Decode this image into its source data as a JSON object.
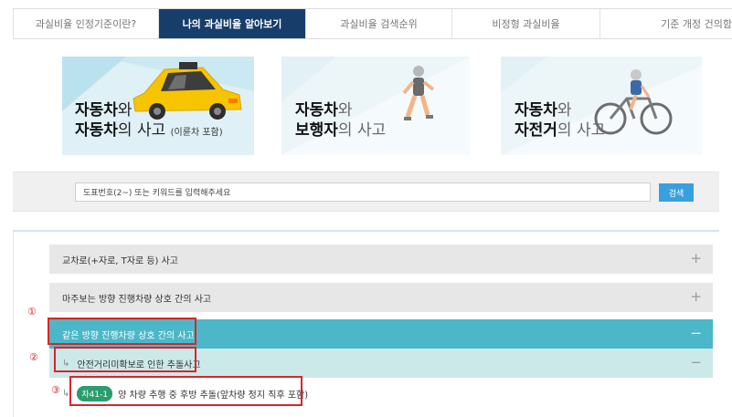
{
  "tabs": [
    {
      "label": "과실비율 인정기준이란?",
      "active": false
    },
    {
      "label": "나의 과실비율 알아보기",
      "active": true
    },
    {
      "label": "과실비율 검색순위",
      "active": false
    },
    {
      "label": "비정형 과실비율",
      "active": false
    },
    {
      "label": "기준 개정 건의함",
      "active": false
    }
  ],
  "cards": [
    {
      "line1_strong": "자동차",
      "line1_rest": "와",
      "line2_strong": "자동차",
      "line2_rest": "의 사고",
      "note": "(이륜차 포함)",
      "icon": "car-icon"
    },
    {
      "line1_strong": "자동차",
      "line1_rest": "와",
      "line2_strong": "보행자",
      "line2_rest": "의 사고",
      "icon": "pedestrian-icon"
    },
    {
      "line1_strong": "자동차",
      "line1_rest": "와",
      "line2_strong": "자전거",
      "line2_rest": "의 사고",
      "icon": "bicycle-icon"
    }
  ],
  "search": {
    "value": "도표번호(2~) 또는 키워드를 입력해주세요",
    "button": "검색"
  },
  "accordion": {
    "rows": [
      {
        "label": "교차로(+자로, T자로 등) 사고",
        "sign": "+"
      },
      {
        "label": "마주보는 방향 진행차량 상호 간의 사고",
        "sign": "+"
      },
      {
        "label": "같은 방향 진행차량 상호 간의 사고",
        "sign": "−"
      },
      {
        "label": "안전거리미확보로 인한 추돌사고",
        "sign": "−",
        "arrow": "↳"
      },
      {
        "badge": "차41-1",
        "label": "양 차량 추행 중 후방 추돌(앞차량 정지 직후 포함)",
        "arrow": "↳"
      }
    ]
  },
  "markers": [
    "①",
    "②",
    "③"
  ],
  "colors": {
    "active_tab": "#173d6b",
    "teal_row": "#4bb7c8",
    "light_teal_row": "#cce9ea",
    "search_button": "#39a0df",
    "badge": "#2a9d6e",
    "annotation_red": "#d9252a"
  }
}
